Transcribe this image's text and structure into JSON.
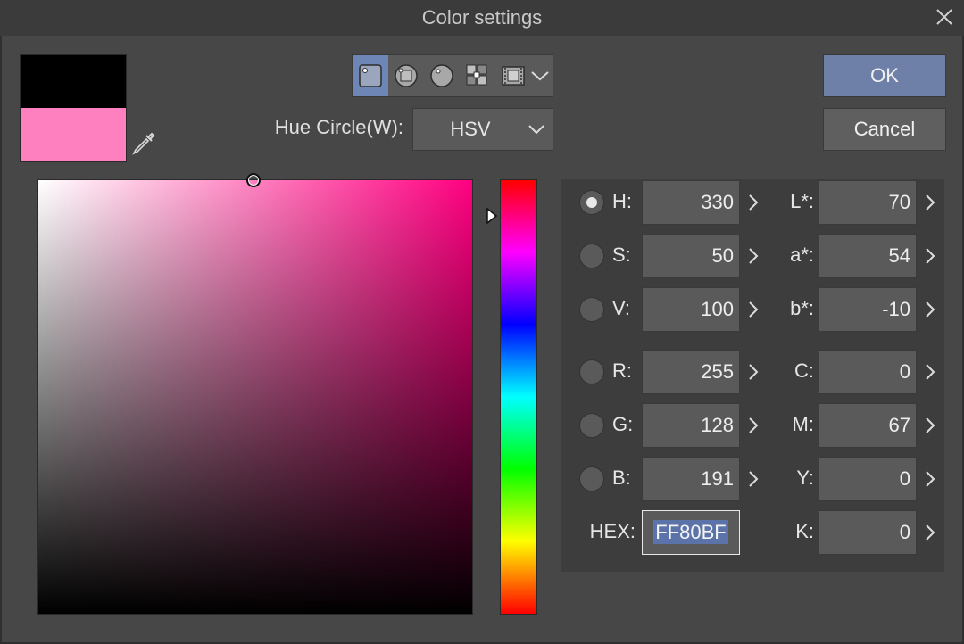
{
  "window": {
    "title": "Color settings"
  },
  "swatches": {
    "main_color": "#000000",
    "sub_color": "#ff80bf"
  },
  "view_modes": {
    "icons": [
      "color-square-icon",
      "hue-circle-rgb-icon",
      "hue-circle-icon",
      "color-set-icon",
      "intermediate-color-icon"
    ],
    "active_index": 0
  },
  "hue_circle": {
    "label": "Hue Circle(W):",
    "value": "HSV"
  },
  "buttons": {
    "ok": "OK",
    "cancel": "Cancel"
  },
  "color": {
    "hue_marker_deg": 330
  },
  "left_fields": [
    {
      "label": "H:",
      "value": "330",
      "checked": true
    },
    {
      "label": "S:",
      "value": "50",
      "checked": false
    },
    {
      "label": "V:",
      "value": "100",
      "checked": false
    },
    {
      "label": "R:",
      "value": "255",
      "checked": false
    },
    {
      "label": "G:",
      "value": "128",
      "checked": false
    },
    {
      "label": "B:",
      "value": "191",
      "checked": false
    }
  ],
  "hex": {
    "label": "HEX:",
    "value": "FF80BF"
  },
  "right_fields": [
    {
      "label": "L*:",
      "value": "70"
    },
    {
      "label": "a*:",
      "value": "54"
    },
    {
      "label": "b*:",
      "value": "-10"
    },
    {
      "label": "C:",
      "value": "0"
    },
    {
      "label": "M:",
      "value": "67"
    },
    {
      "label": "Y:",
      "value": "0"
    },
    {
      "label": "K:",
      "value": "0"
    }
  ],
  "colors": {
    "accent": "#6e86b6",
    "ok_button": "#6e7fa8",
    "background": "#474747"
  }
}
